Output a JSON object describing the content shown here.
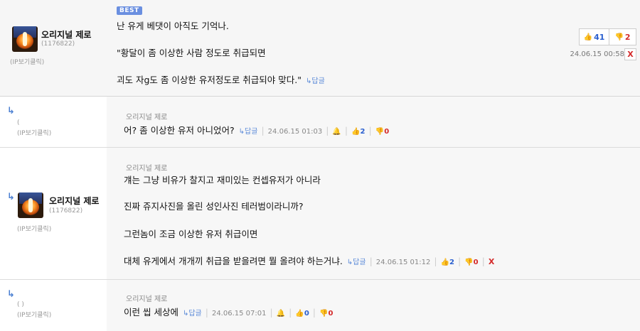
{
  "best": {
    "badge": "BEST",
    "nick": "오리지널 제로",
    "uid": "(1176822)",
    "ip": "(IP보기클릭)",
    "lines": [
      "난 유게 베댓이 아직도 기억나.",
      "\"황달이 좀 이상한 사람 정도로 취급되면",
      "괴도 자g도 좀 이상한 유저정도로 취급되야 맞다.\""
    ],
    "reply_label": "↳답글",
    "up": "41",
    "down": "2",
    "date": "24.06.15 00:58",
    "delete": "X"
  },
  "replies": [
    {
      "ip": "(IP보기클릭)",
      "paren": "(",
      "to_nick": "오리지널 제로",
      "lines": [
        "어? 좀 이상한 유저 아니었어?"
      ],
      "reply_label": "↳답글",
      "date": "24.06.15 01:03",
      "up": "2",
      "down": "0"
    },
    {
      "nick": "오리지널 제로",
      "uid": "(1176822)",
      "ip": "(IP보기클릭)",
      "to_nick": "오리지널 제로",
      "lines": [
        "걔는 그냥 비유가 찰지고 재미있는 컨셉유저가 아니라",
        "진짜 쥬지사진을 올린 성인사진 테러범이라니까?",
        "그런놈이 조금 이상한 유저 취급이면",
        "대체 유게에서 개개끼 취급을 받을려면 뭘 올려야 하는거냐."
      ],
      "reply_label": "↳답글",
      "date": "24.06.15 01:12",
      "up": "2",
      "down": "0",
      "delete": "X"
    },
    {
      "ip": "(IP보기클릭)",
      "paren": "(            )",
      "to_nick": "오리지널 제로",
      "lines": [
        "이런 씹 세상에"
      ],
      "reply_label": "↳답글",
      "date": "24.06.15 07:01",
      "up": "0",
      "down": "0"
    }
  ],
  "icons": {
    "thumb_up": "thumbs-up-icon",
    "thumb_down": "thumbs-down-icon",
    "report": "report-bell-icon",
    "reply_arrow": "reply-arrow-icon"
  },
  "colors": {
    "up": "#2a5fcf",
    "down": "#d42a2a",
    "badge": "#6a8fe0",
    "reply_link": "#5b8ad8"
  }
}
